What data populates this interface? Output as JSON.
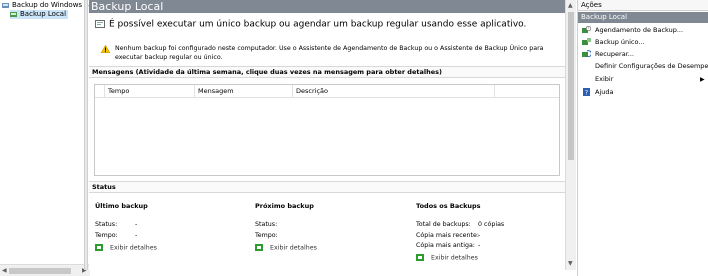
{
  "tree": {
    "root_label": "Backup do Windows Serve",
    "child_label": "Backup Local"
  },
  "main": {
    "title": "Backup Local",
    "intro": "É possível executar um único backup ou agendar um backup regular usando esse aplicativo.",
    "warning": "Nenhum backup foi configurado neste computador. Use o Assistente de Agendamento de Backup ou o Assistente de Backup Único para executar backup regular ou único.",
    "messages_heading": "Mensagens (Atividade da última semana, clique duas vezes na mensagem para obter detalhes)",
    "table_columns": [
      "Tempo",
      "Mensagem",
      "Descrição"
    ],
    "status_heading": "Status",
    "last_backup": {
      "title": "Último backup",
      "status_label": "Status:",
      "status_value": "-",
      "time_label": "Tempo:",
      "time_value": "-",
      "details_link": "Exibir detalhes"
    },
    "next_backup": {
      "title": "Próximo backup",
      "status_label": "Status:",
      "status_value": "",
      "time_label": "Tempo:",
      "time_value": "",
      "details_link": "Exibir detalhes"
    },
    "all_backups": {
      "title": "Todos os Backups",
      "total_label": "Total de backups:",
      "total_value": "0 cópias",
      "recent_label": "Cópia mais recente:",
      "recent_value": "-",
      "oldest_label": "Cópia mais antiga:",
      "oldest_value": "-",
      "details_link": "Exibir detalhes"
    }
  },
  "actions": {
    "title": "Ações",
    "section": "Backup Local",
    "items": [
      {
        "label": "Agendamento de Backup...",
        "icon": "schedule-backup-icon"
      },
      {
        "label": "Backup único...",
        "icon": "backup-once-icon"
      },
      {
        "label": "Recuperar...",
        "icon": "recover-icon"
      },
      {
        "label": "Definir Configurações de Desempe...",
        "icon": ""
      },
      {
        "label": "Exibir",
        "icon": ""
      },
      {
        "label": "Ajuda",
        "icon": "help-icon"
      }
    ]
  },
  "colors": {
    "title_bar": "#7f8893",
    "link_green": "#2e9b2e",
    "warning_yellow": "#f2c200",
    "help_blue": "#2b5fb4"
  }
}
